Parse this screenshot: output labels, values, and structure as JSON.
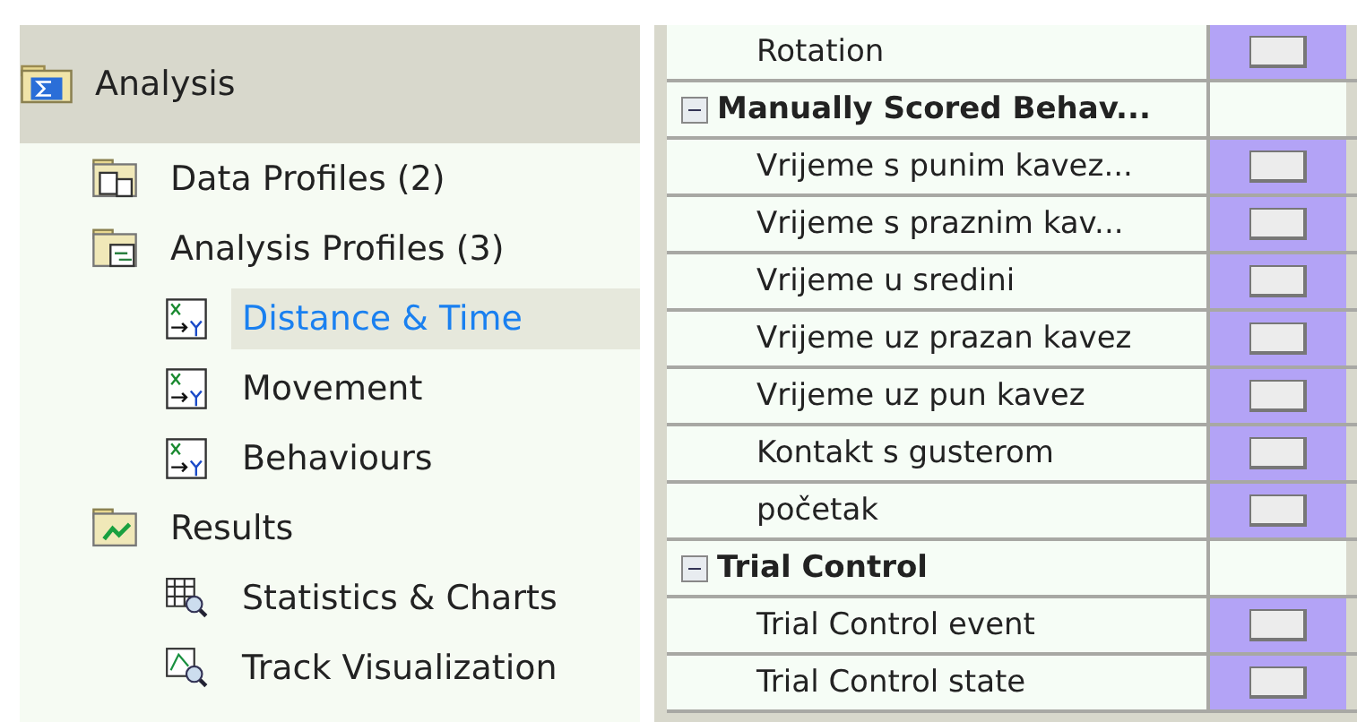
{
  "analysis_panel": {
    "title": "Analysis",
    "tree": [
      {
        "label": "Data Profiles (2)",
        "kind": "data-folder",
        "selected": false
      },
      {
        "label": "Analysis Profiles (3)",
        "kind": "analysis-folder",
        "selected": false,
        "children": [
          {
            "label": "Distance & Time",
            "kind": "profile",
            "selected": true
          },
          {
            "label": "Movement",
            "kind": "profile",
            "selected": false
          },
          {
            "label": "Behaviours",
            "kind": "profile",
            "selected": false
          }
        ]
      },
      {
        "label": "Results",
        "kind": "results-folder",
        "selected": false,
        "children": [
          {
            "label": "Statistics & Charts",
            "kind": "statistics",
            "selected": false
          },
          {
            "label": "Track Visualization",
            "kind": "track",
            "selected": false
          }
        ]
      }
    ]
  },
  "variables_table": {
    "rows": [
      {
        "kind": "item",
        "label": "Rotation"
      },
      {
        "kind": "group",
        "label": "Manually Scored Behav...",
        "expanded": true
      },
      {
        "kind": "item",
        "label": "Vrijeme s punim kavez..."
      },
      {
        "kind": "item",
        "label": "Vrijeme s praznim kav..."
      },
      {
        "kind": "item",
        "label": "Vrijeme u sredini"
      },
      {
        "kind": "item",
        "label": "Vrijeme uz prazan kavez"
      },
      {
        "kind": "item",
        "label": "Vrijeme uz pun kavez"
      },
      {
        "kind": "item",
        "label": "Kontakt s gusterom"
      },
      {
        "kind": "item",
        "label": "početak"
      },
      {
        "kind": "group",
        "label": "Trial Control",
        "expanded": true
      },
      {
        "kind": "item",
        "label": "Trial Control event"
      },
      {
        "kind": "item",
        "label": "Trial Control state"
      }
    ]
  }
}
